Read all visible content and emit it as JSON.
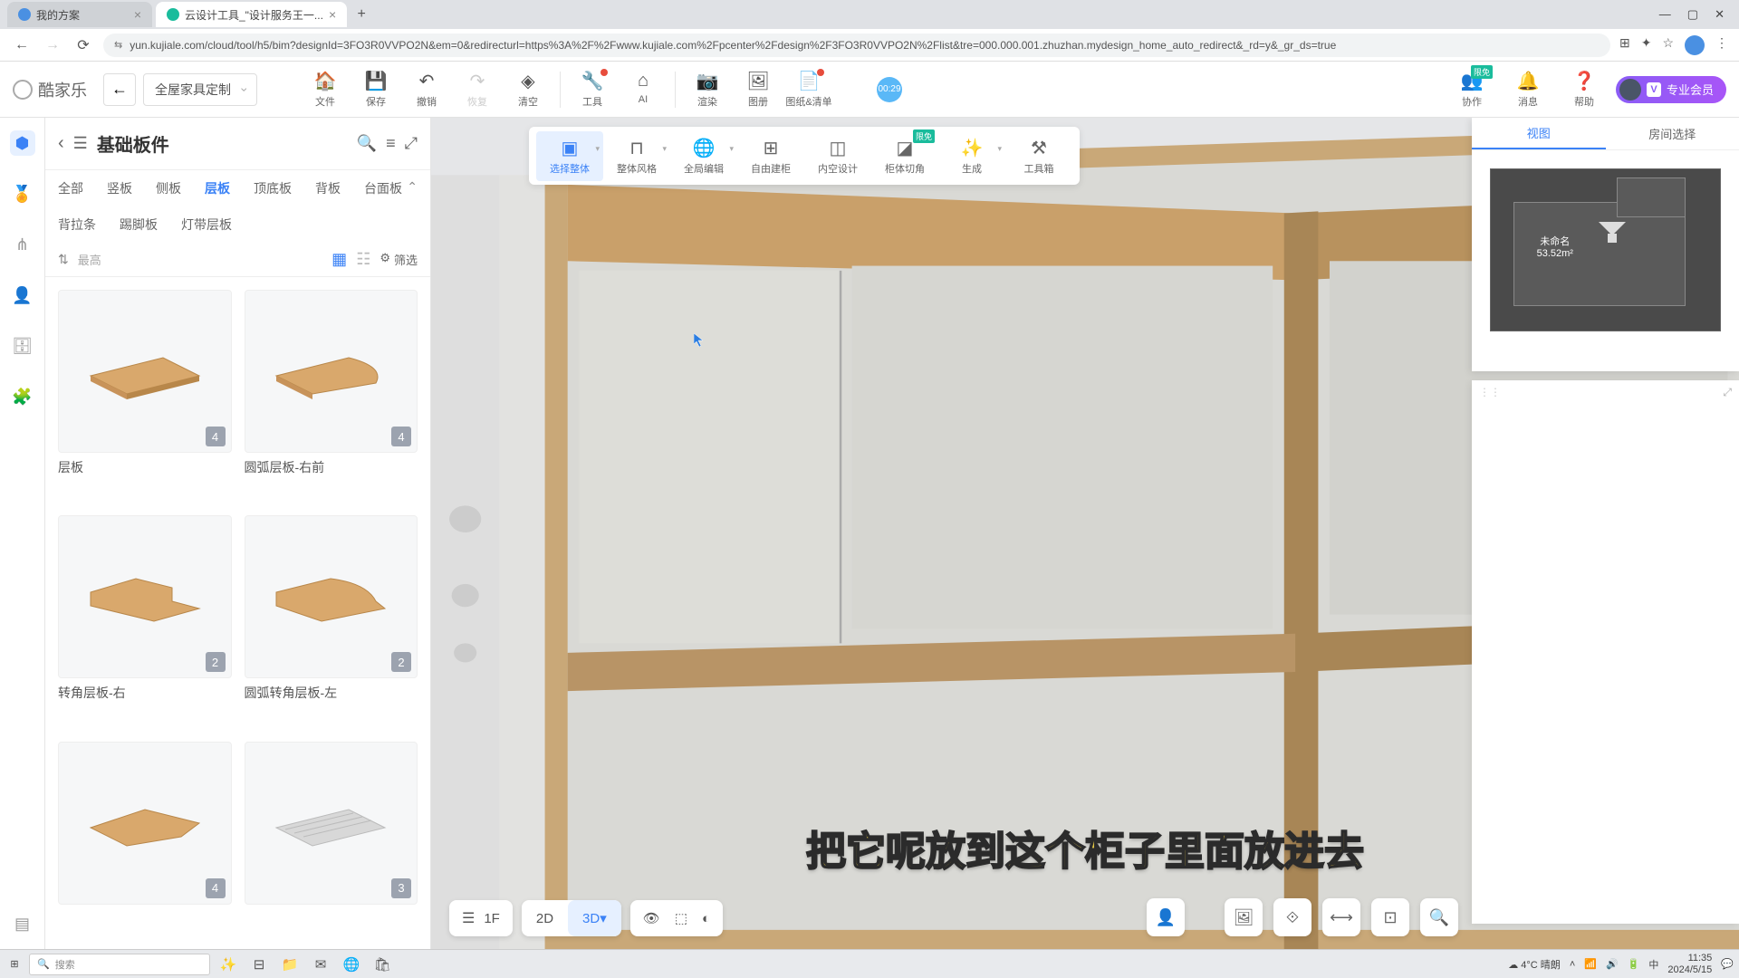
{
  "browser": {
    "tabs": [
      {
        "title": "我的方案",
        "active": false
      },
      {
        "title": "云设计工具_\"设计服务王一...",
        "active": true
      }
    ],
    "url": "yun.kujiale.com/cloud/tool/h5/bim?designId=3FO3R0VVPO2N&em=0&redirecturl=https%3A%2F%2Fwww.kujiale.com%2Fpcenter%2Fdesign%2F3FO3R0VVPO2N%2Flist&tre=000.000.001.zhuzhan.mydesign_home_auto_redirect&_rd=y&_gr_ds=true"
  },
  "app": {
    "logo": "酷家乐",
    "mode": "全屋家具定制",
    "toolbar": {
      "file": "文件",
      "save": "保存",
      "undo": "撤销",
      "redo": "恢复",
      "clear": "清空",
      "tool": "工具",
      "ai": "AI",
      "render": "渲染",
      "gallery": "图册",
      "drawings": "图纸&清单",
      "collab": "协作",
      "msg": "消息",
      "help": "帮助"
    },
    "bubble": "00:29",
    "member": "专业会员",
    "member_v": "V",
    "badge_free": "限免"
  },
  "sidebar": {
    "title": "基础板件",
    "cats": [
      "全部",
      "竖板",
      "侧板",
      "层板",
      "顶底板",
      "背板",
      "台面板",
      "背拉条",
      "踢脚板",
      "灯带层板"
    ],
    "active_cat": "层板",
    "sort": "最高",
    "filter": "筛选",
    "items": [
      {
        "name": "层板",
        "count": "4",
        "shape": "rect"
      },
      {
        "name": "圆弧层板-右前",
        "count": "4",
        "shape": "arc-rf"
      },
      {
        "name": "转角层板-右",
        "count": "2",
        "shape": "corner-r"
      },
      {
        "name": "圆弧转角层板-左",
        "count": "2",
        "shape": "arc-corner-l"
      },
      {
        "name": "",
        "count": "4",
        "shape": "rect2"
      },
      {
        "name": "",
        "count": "3",
        "shape": "slat"
      }
    ]
  },
  "float": {
    "items": [
      {
        "label": "选择整体",
        "active": true,
        "drop": true
      },
      {
        "label": "整体风格",
        "drop": true
      },
      {
        "label": "全局编辑",
        "drop": true
      },
      {
        "label": "自由建柜"
      },
      {
        "label": "内空设计"
      },
      {
        "label": "柜体切角",
        "badge": "限免"
      },
      {
        "label": "生成",
        "drop": true
      },
      {
        "label": "工具箱"
      }
    ]
  },
  "minimap": {
    "tab_view": "视图",
    "tab_room": "房间选择",
    "room_name": "未命名",
    "room_area": "53.52m²"
  },
  "bottom": {
    "floor": "1F",
    "d2": "2D",
    "d3": "3D"
  },
  "subtitle": "把它呢放到这个柜子里面放进去",
  "taskbar": {
    "search": "搜索",
    "weather": "4°C 晴朗",
    "time": "11:35",
    "date": "2024/5/15"
  }
}
